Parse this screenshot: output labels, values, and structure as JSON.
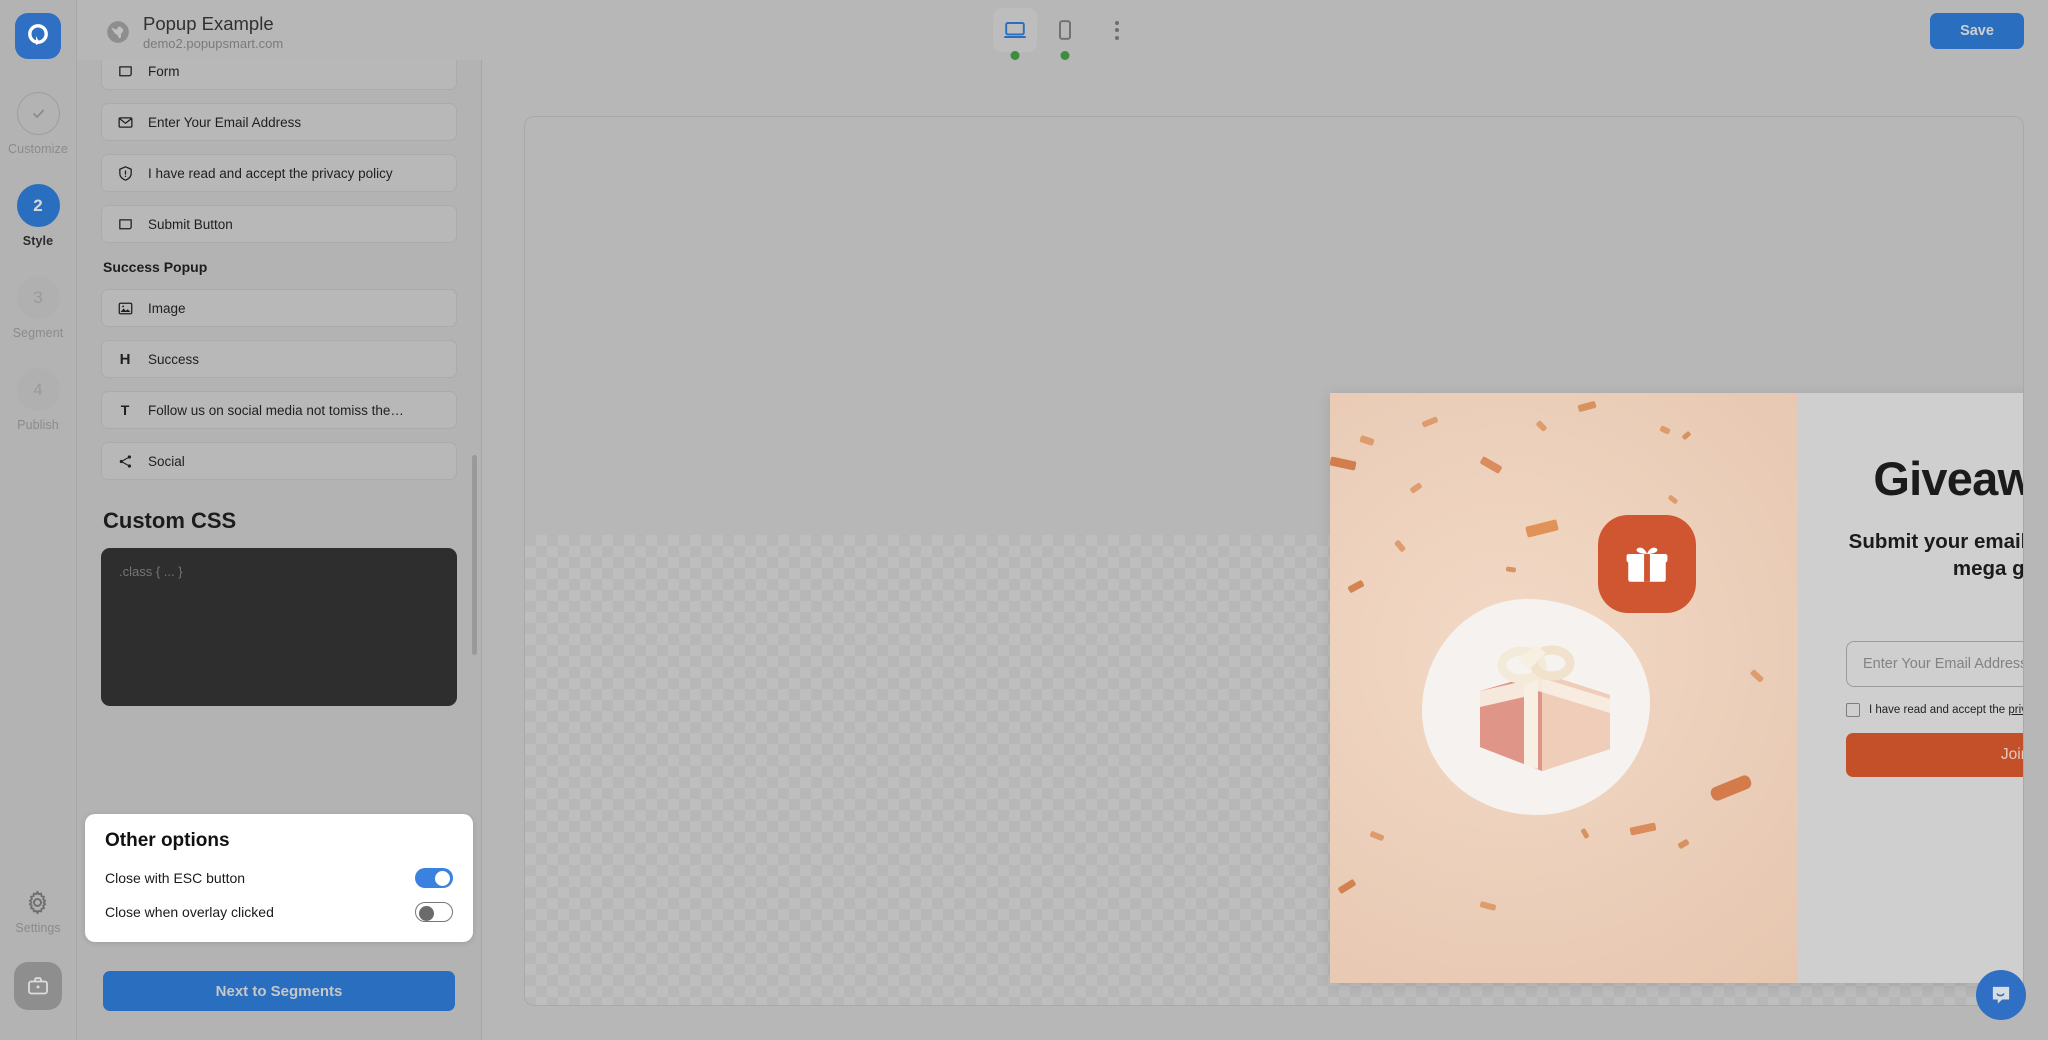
{
  "rail": {
    "logo_icon": "popupsmart-logo-icon",
    "steps": [
      {
        "num": "✓",
        "label": "Customize",
        "state": "done"
      },
      {
        "num": "2",
        "label": "Style",
        "state": "active"
      },
      {
        "num": "3",
        "label": "Segment",
        "state": "muted"
      },
      {
        "num": "4",
        "label": "Publish",
        "state": "muted"
      }
    ],
    "settings_label": "Settings",
    "settings_icon": "gear-icon",
    "briefcase_icon": "briefcase-icon"
  },
  "topbar": {
    "globe_icon": "globe-icon",
    "title": "Popup Example",
    "url": "demo2.popupsmart.com",
    "devices": [
      {
        "name": "desktop",
        "icon": "desktop-icon",
        "active": true,
        "status_dot": "#3f8c3f"
      },
      {
        "name": "mobile",
        "icon": "mobile-icon",
        "active": false,
        "status_dot": "#3f8c3f"
      }
    ],
    "more_icon": "kebab-menu-icon",
    "save_label": "Save"
  },
  "panel": {
    "top_elements": [
      {
        "icon": "form-icon",
        "label": "Form"
      },
      {
        "icon": "envelope-icon",
        "label": "Enter Your Email Address"
      },
      {
        "icon": "shield-icon",
        "label": "I have read and accept the privacy policy"
      },
      {
        "icon": "button-icon",
        "label": "Submit Button"
      }
    ],
    "success_section_title": "Success Popup",
    "success_elements": [
      {
        "icon": "image-icon",
        "label": "Image"
      },
      {
        "icon": "heading-icon",
        "label": "Success"
      },
      {
        "icon": "text-icon",
        "label": "Follow us on social media not tomiss the…"
      },
      {
        "icon": "share-icon",
        "label": "Social"
      }
    ],
    "custom_css_title": "Custom CSS",
    "custom_css_placeholder": ".class { ... }",
    "custom_css_value": ""
  },
  "other_options": {
    "title": "Other options",
    "rows": [
      {
        "label": "Close with ESC button",
        "on": true
      },
      {
        "label": "Close when overlay clicked",
        "on": false
      }
    ]
  },
  "next_button_label": "Next to Segments",
  "popup": {
    "close_icon": "close-icon",
    "image": {
      "alt": "gift-box-illustration",
      "badge_icon": "gift-icon",
      "bg_color": "#ecd0bb",
      "badge_color": "#cf5630"
    },
    "heading": "Giveaway time",
    "subheading": "Submit your email address to join the mega giveaway!",
    "email_placeholder": "Enter Your Email Address",
    "email_value": "",
    "email_icon": "envelope-icon",
    "required_badge": "✻",
    "consent_text": "I have read and accept the ",
    "consent_link": "privacy policy",
    "submit_label": "Join now",
    "submit_color": "#c4502a"
  },
  "chat": {
    "icon": "chat-bubble-icon",
    "color": "#2f6fc4"
  }
}
